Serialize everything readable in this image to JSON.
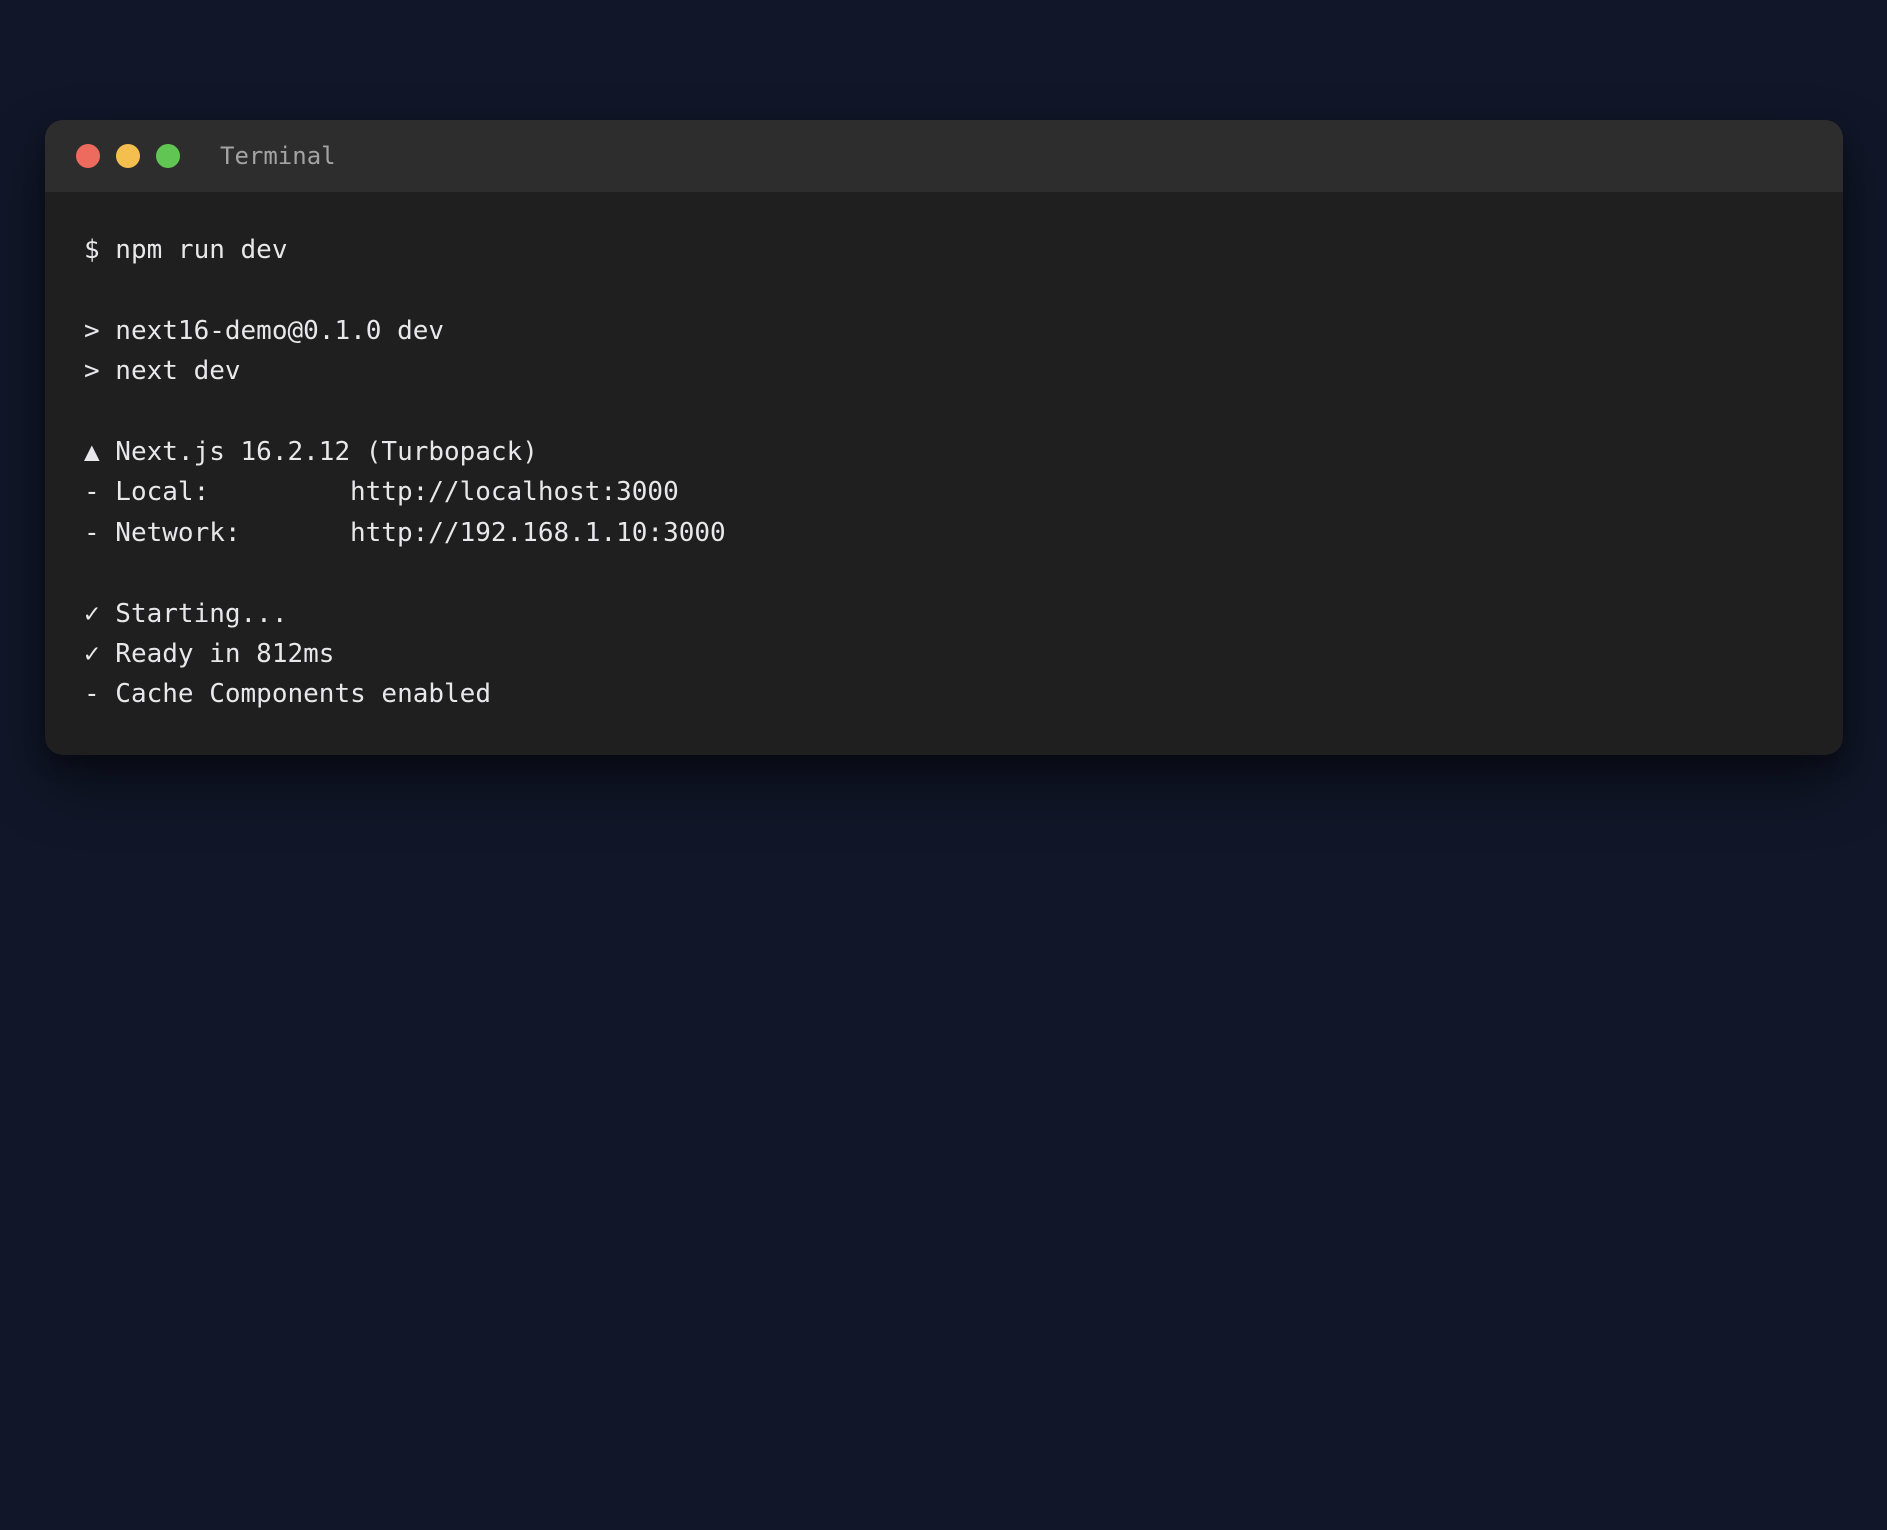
{
  "window": {
    "title": "Terminal",
    "controls": {
      "close_color": "#ed6a5e",
      "minimize_color": "#f5bf4f",
      "maximize_color": "#61c554"
    }
  },
  "terminal": {
    "prompt": "$ npm run dev",
    "script_lines": [
      "> next16-demo@0.1.0 dev",
      "> next dev"
    ],
    "framework_line": "▲ Next.js 16.2.12 (Turbopack)",
    "local": {
      "label": "- Local:",
      "url": "http://localhost:3000"
    },
    "network": {
      "label": "- Network:",
      "url": "http://192.168.1.10:3000"
    },
    "status_lines": [
      "✓ Starting...",
      "✓ Ready in 812ms",
      "- Cache Components enabled"
    ]
  }
}
